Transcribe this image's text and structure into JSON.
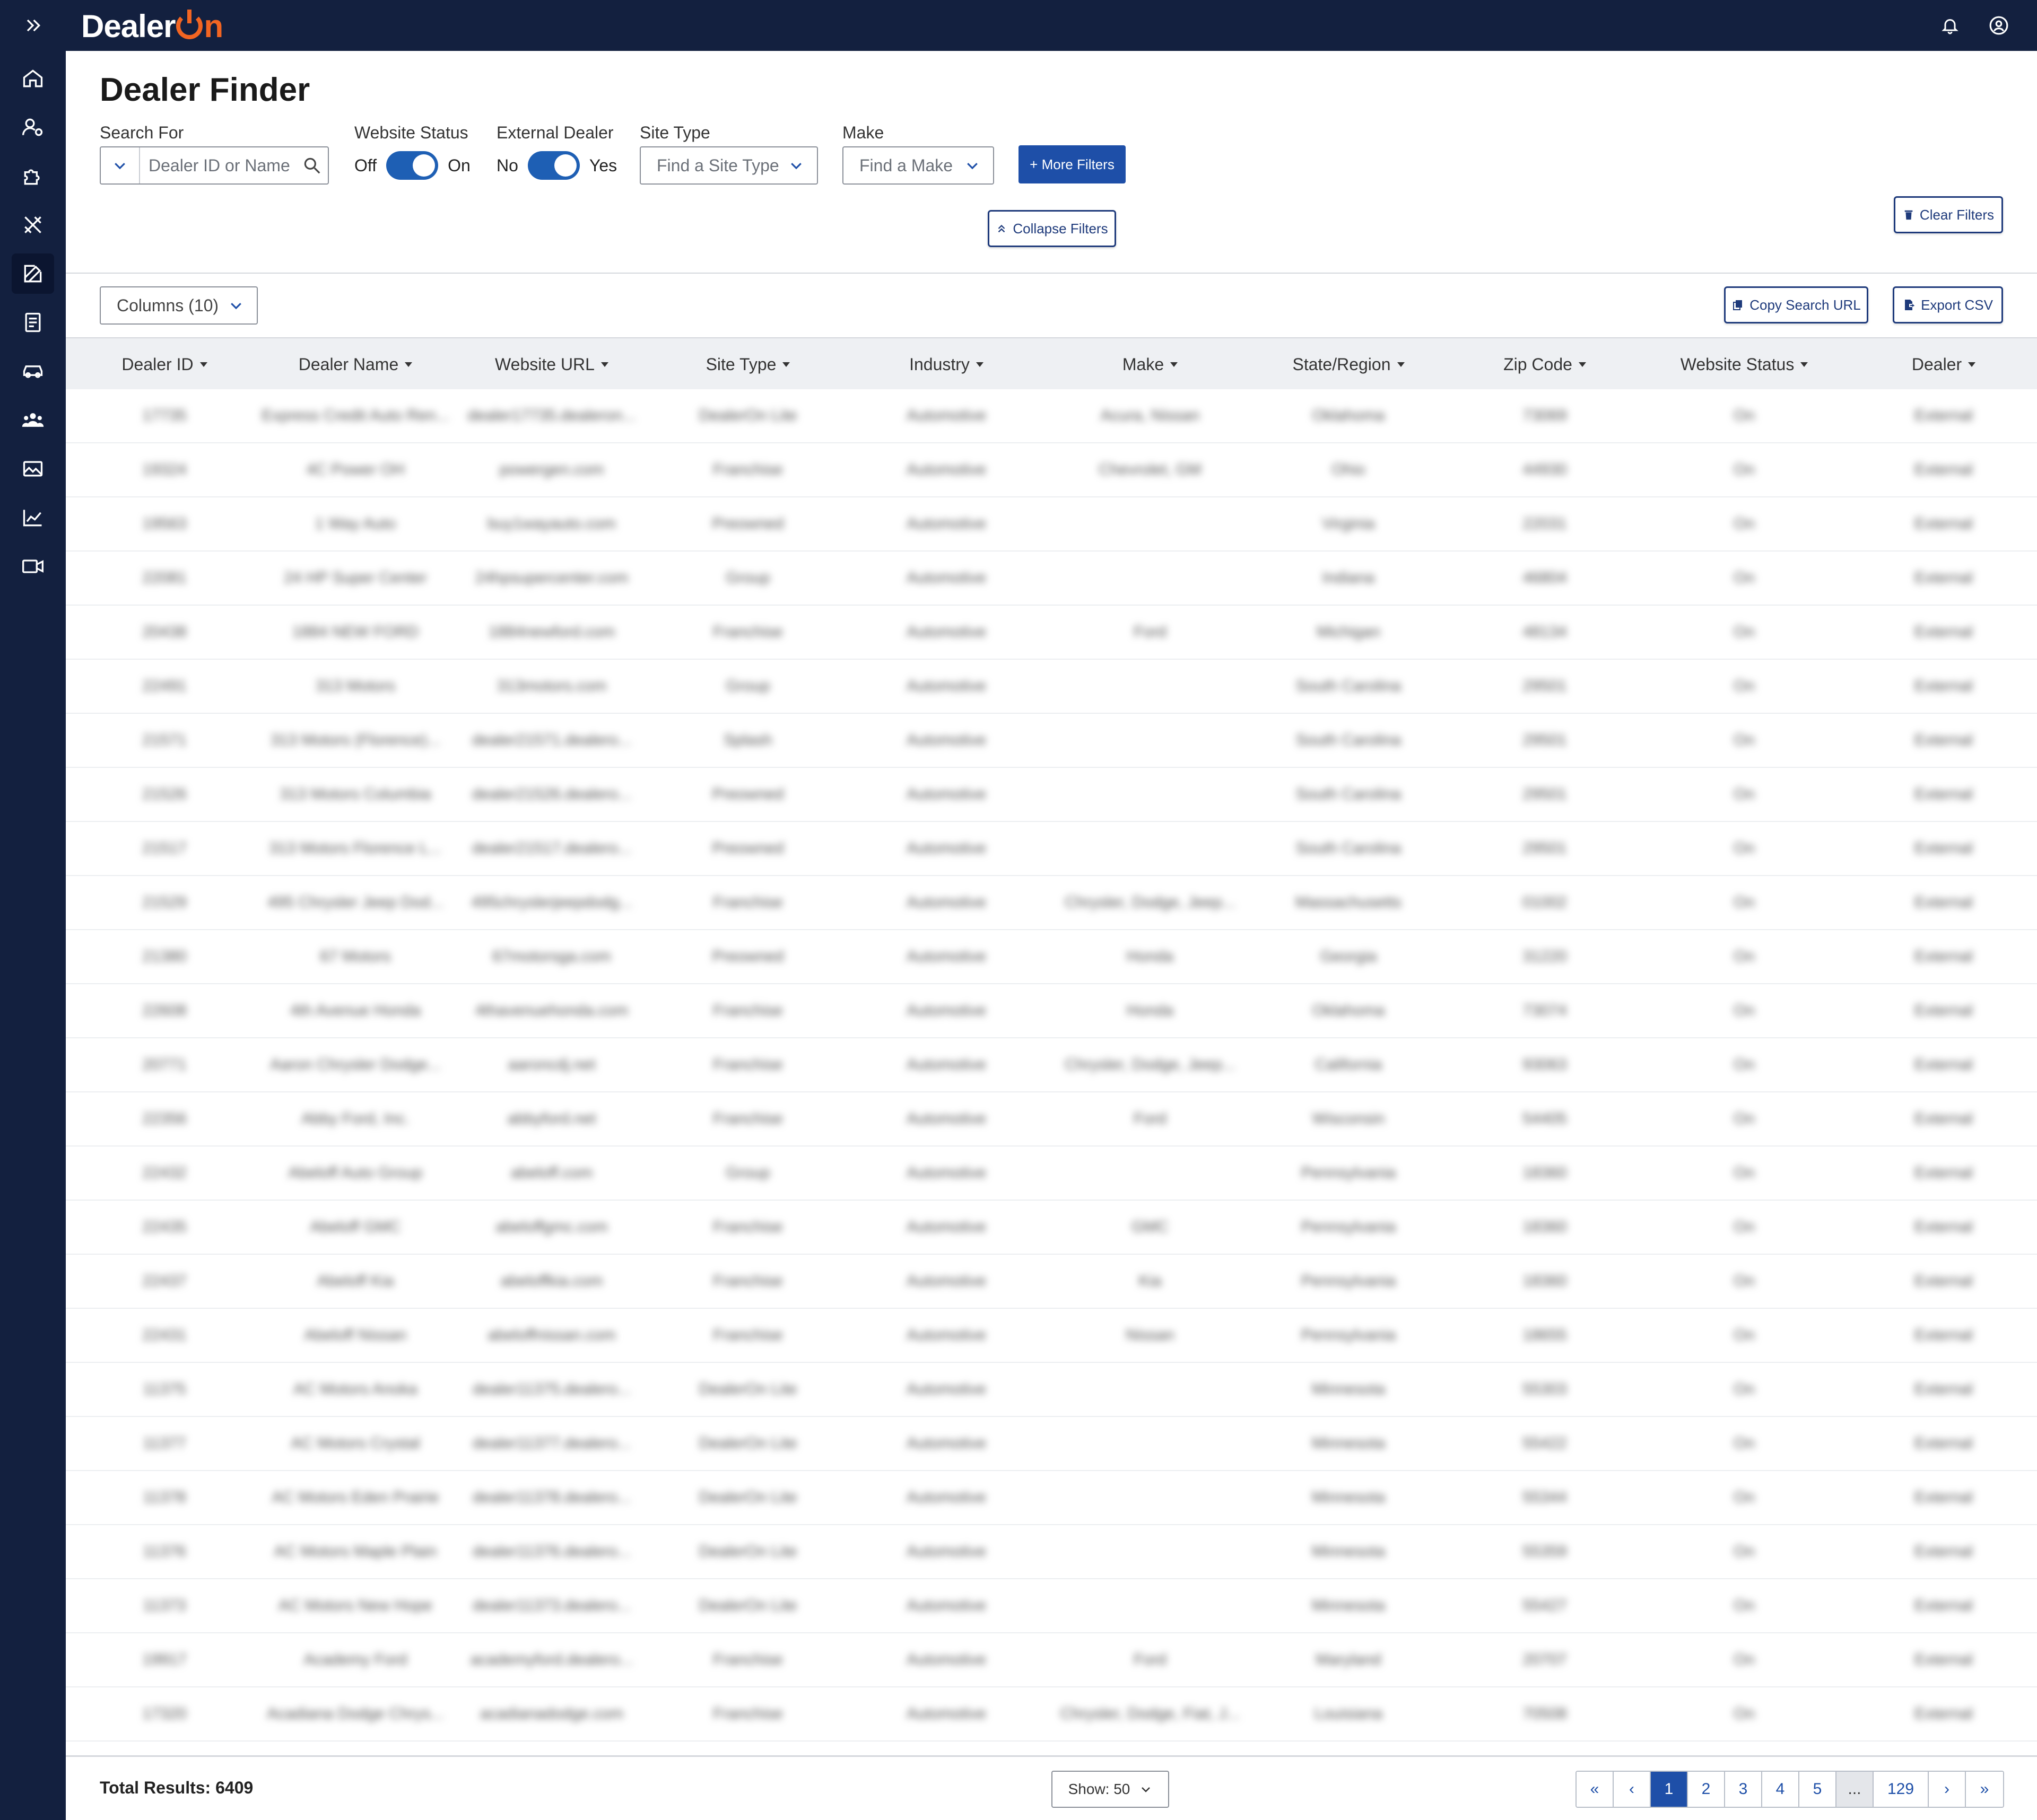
{
  "brand": {
    "logo_text_a": "Dealer",
    "logo_text_b": "n",
    "accent": "#f26522",
    "navy": "#13203f",
    "primary": "#1e4fa8"
  },
  "topbar": {
    "icons": [
      "bell-icon",
      "account-icon"
    ]
  },
  "sidebar": {
    "expand_icon": "double-chevron-right-icon",
    "items": [
      {
        "icon": "home-icon",
        "active": false
      },
      {
        "icon": "user-settings-icon",
        "active": false
      },
      {
        "icon": "puzzle-icon",
        "active": false
      },
      {
        "icon": "tools-icon",
        "active": false
      },
      {
        "icon": "edit-icon",
        "active": true
      },
      {
        "icon": "receipt-icon",
        "active": false
      },
      {
        "icon": "car-icon",
        "active": false
      },
      {
        "icon": "users-icon",
        "active": false
      },
      {
        "icon": "images-icon",
        "active": false
      },
      {
        "icon": "chart-icon",
        "active": false
      },
      {
        "icon": "video-icon",
        "active": false
      }
    ]
  },
  "page": {
    "title": "Dealer Finder"
  },
  "filters": {
    "search_label": "Search For",
    "search_placeholder": "Dealer ID or Name",
    "website_status_label": "Website Status",
    "website_status_off": "Off",
    "website_status_on": "On",
    "website_status_value": true,
    "external_dealer_label": "External Dealer",
    "external_dealer_no": "No",
    "external_dealer_yes": "Yes",
    "external_dealer_value": true,
    "site_type_label": "Site Type",
    "site_type_placeholder": "Find a Site Type",
    "make_label": "Make",
    "make_placeholder": "Find a Make",
    "more_filters": "+ More Filters",
    "collapse_filters": "Collapse Filters",
    "clear_filters": "Clear Filters"
  },
  "toolbar": {
    "columns": "Columns (10)",
    "copy_search_url": "Copy Search URL",
    "export_csv": "Export CSV"
  },
  "table": {
    "headers": [
      "Dealer ID",
      "Website Status",
      "Dealer Name",
      "Website URL",
      "Site Type",
      "Industry",
      "Make",
      "State/Region",
      "Zip Code",
      "Dealer"
    ],
    "columns": [
      "Dealer ID",
      "Dealer Name",
      "Website URL",
      "Site Type",
      "Industry",
      "Make",
      "State/Region",
      "Zip Code",
      "Website Status",
      "Dealer"
    ],
    "rows": [
      [
        "17735",
        "Express Credit Auto Ren...",
        "dealer17735.dealeron...",
        "DealerOn Lite",
        "Automotive",
        "Acura, Nissan",
        "Oklahoma",
        "73069",
        "On",
        "External"
      ],
      [
        "19324",
        "4C Power OH",
        "powergen.com",
        "Franchise",
        "Automotive",
        "Chevrolet, GM",
        "Ohio",
        "44930",
        "On",
        "External"
      ],
      [
        "19563",
        "1 Way Auto",
        "buy1wayauto.com",
        "Preowned",
        "Automotive",
        "",
        "Virginia",
        "22031",
        "On",
        "External"
      ],
      [
        "22081",
        "24 HP Super Center",
        "24hpsupercenter.com",
        "Group",
        "Automotive",
        "",
        "Indiana",
        "46804",
        "On",
        "External"
      ],
      [
        "20438",
        "1884 NEW FORD",
        "1884newford.com",
        "Franchise",
        "Automotive",
        "Ford",
        "Michigan",
        "48134",
        "On",
        "External"
      ],
      [
        "22491",
        "313 Motors",
        "313motors.com",
        "Group",
        "Automotive",
        "",
        "South Carolina",
        "29501",
        "On",
        "External"
      ],
      [
        "21571",
        "313 Motors (Florence)...",
        "dealer21571.dealero...",
        "Splash",
        "Automotive",
        "",
        "South Carolina",
        "29501",
        "On",
        "External"
      ],
      [
        "21526",
        "313 Motors Columbia",
        "dealer21526.dealero...",
        "Preowned",
        "Automotive",
        "",
        "South Carolina",
        "29501",
        "On",
        "External"
      ],
      [
        "21517",
        "313 Motors Florence L...",
        "dealer21517.dealero...",
        "Preowned",
        "Automotive",
        "",
        "South Carolina",
        "29501",
        "On",
        "External"
      ],
      [
        "21529",
        "495 Chrysler Jeep Dod...",
        "495chryslerjeepdodg...",
        "Franchise",
        "Automotive",
        "Chrysler, Dodge, Jeep...",
        "Massachusetts",
        "01002",
        "On",
        "External"
      ],
      [
        "21380",
        "67 Motors",
        "67motorsga.com",
        "Preowned",
        "Automotive",
        "Honda",
        "Georgia",
        "31220",
        "On",
        "External"
      ],
      [
        "22608",
        "4th Avenue Honda",
        "4thavenuehonda.com",
        "Franchise",
        "Automotive",
        "Honda",
        "Oklahoma",
        "73074",
        "On",
        "External"
      ],
      [
        "20771",
        "Aaron Chrysler Dodge...",
        "aaroncdj.net",
        "Franchise",
        "Automotive",
        "Chrysler, Dodge, Jeep...",
        "California",
        "93063",
        "On",
        "External"
      ],
      [
        "22356",
        "Abby Ford, Inc.",
        "abbyford.net",
        "Franchise",
        "Automotive",
        "Ford",
        "Wisconsin",
        "54405",
        "On",
        "External"
      ],
      [
        "22432",
        "Abeloff Auto Group",
        "abeloff.com",
        "Group",
        "Automotive",
        "",
        "Pennsylvania",
        "18360",
        "On",
        "External"
      ],
      [
        "22435",
        "Abeloff GMC",
        "abeloffgmc.com",
        "Franchise",
        "Automotive",
        "GMC",
        "Pennsylvania",
        "18360",
        "On",
        "External"
      ],
      [
        "22437",
        "Abeloff Kia",
        "abeloffkia.com",
        "Franchise",
        "Automotive",
        "Kia",
        "Pennsylvania",
        "18360",
        "On",
        "External"
      ],
      [
        "22431",
        "Abeloff Nissan",
        "abeloffnissan.com",
        "Franchise",
        "Automotive",
        "Nissan",
        "Pennsylvania",
        "18655",
        "On",
        "External"
      ],
      [
        "11375",
        "AC Motors Anoka",
        "dealer11375.dealero...",
        "DealerOn Lite",
        "Automotive",
        "",
        "Minnesota",
        "55303",
        "On",
        "External"
      ],
      [
        "11377",
        "AC Motors Crystal",
        "dealer11377.dealero...",
        "DealerOn Lite",
        "Automotive",
        "",
        "Minnesota",
        "55422",
        "On",
        "External"
      ],
      [
        "11378",
        "AC Motors Eden Prairie",
        "dealer11378.dealero...",
        "DealerOn Lite",
        "Automotive",
        "",
        "Minnesota",
        "55344",
        "On",
        "External"
      ],
      [
        "11376",
        "AC Motors Maple Plain",
        "dealer11376.dealero...",
        "DealerOn Lite",
        "Automotive",
        "",
        "Minnesota",
        "55359",
        "On",
        "External"
      ],
      [
        "11373",
        "AC Motors New Hope",
        "dealer11373.dealero...",
        "DealerOn Lite",
        "Automotive",
        "",
        "Minnesota",
        "55427",
        "On",
        "External"
      ],
      [
        "19917",
        "Academy Ford",
        "academyford.dealero...",
        "Franchise",
        "Automotive",
        "Ford",
        "Maryland",
        "20707",
        "On",
        "External"
      ],
      [
        "17320",
        "Acadiana Dodge Chrys...",
        "acadianadodge.com",
        "Franchise",
        "Automotive",
        "Chrysler, Dodge, Fiat, J...",
        "Louisiana",
        "70508",
        "On",
        "External"
      ]
    ]
  },
  "footer": {
    "total_results": "Total Results: 6409",
    "show": "Show: 50",
    "pages": [
      "«",
      "‹",
      "1",
      "2",
      "3",
      "4",
      "5",
      "...",
      "129",
      "›",
      "»"
    ],
    "current_page": "1"
  }
}
